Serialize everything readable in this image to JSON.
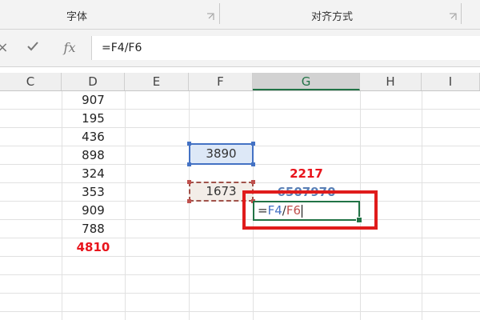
{
  "ribbon": {
    "groups": [
      {
        "label": "字体"
      },
      {
        "label": "对齐方式"
      }
    ]
  },
  "formula_bar": {
    "formula": "=F4/F6"
  },
  "columns": [
    "C",
    "D",
    "E",
    "F",
    "G",
    "H",
    "I"
  ],
  "selected_column": "G",
  "column_d": [
    "907",
    "195",
    "436",
    "898",
    "324",
    "353",
    "909",
    "788"
  ],
  "column_d_total": "4810",
  "cells": {
    "f4": "3890",
    "f6": "1673",
    "g5": "2217",
    "g6": "6507970"
  },
  "active_cell": {
    "eq": "=",
    "ref1": "F4",
    "op": "/",
    "ref2": "F6"
  },
  "colors": {
    "accent_green": "#217346",
    "highlight_red": "#e01b1b",
    "ref_blue": "#4472c4",
    "ref_red": "#c0504d"
  }
}
